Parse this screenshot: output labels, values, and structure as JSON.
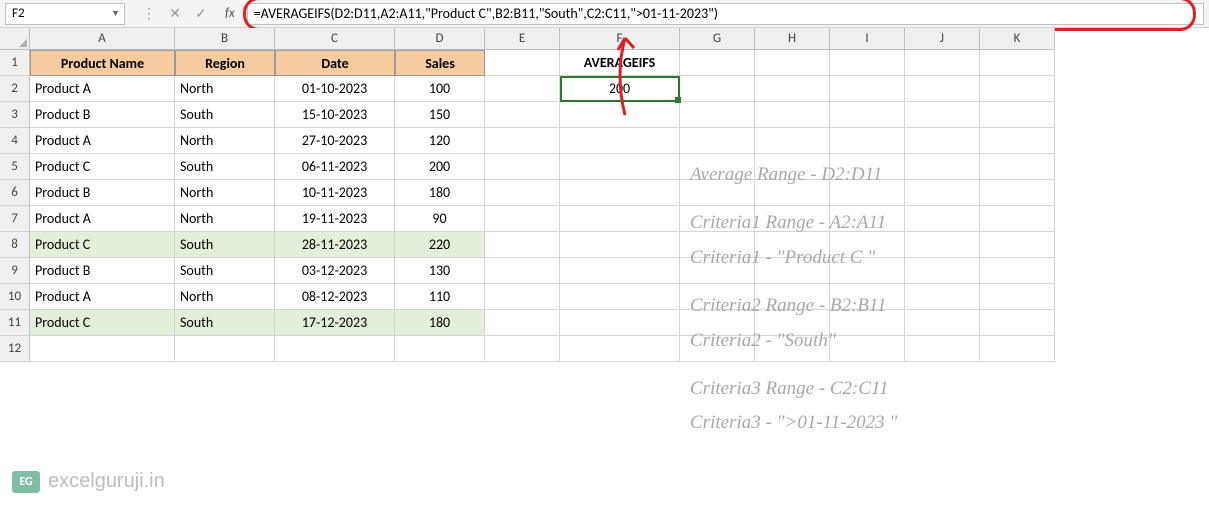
{
  "name_box": "F2",
  "formula_bar": "=AVERAGEIFS(D2:D11,A2:A11,\"Product C\",B2:B11,\"South\",C2:C11,\">01-11-2023\")",
  "columns": [
    "A",
    "B",
    "C",
    "D",
    "E",
    "F",
    "G",
    "H",
    "I",
    "J",
    "K"
  ],
  "row_numbers": [
    "1",
    "2",
    "3",
    "4",
    "5",
    "6",
    "7",
    "8",
    "9",
    "10",
    "11",
    "12"
  ],
  "headers": {
    "A": "Product Name",
    "B": "Region",
    "C": "Date",
    "D": "Sales"
  },
  "averageifs_label": "AVERAGEIFS",
  "averageifs_value": "200",
  "table": [
    {
      "A": "Product A",
      "B": "North",
      "C": "01-10-2023",
      "D": "100",
      "hl": false
    },
    {
      "A": "Product B",
      "B": "South",
      "C": "15-10-2023",
      "D": "150",
      "hl": false
    },
    {
      "A": "Product A",
      "B": "North",
      "C": "27-10-2023",
      "D": "120",
      "hl": false
    },
    {
      "A": "Product C",
      "B": "South",
      "C": "06-11-2023",
      "D": "200",
      "hl": false
    },
    {
      "A": "Product B",
      "B": "North",
      "C": "10-11-2023",
      "D": "180",
      "hl": false
    },
    {
      "A": "Product A",
      "B": "North",
      "C": "19-11-2023",
      "D": "90",
      "hl": false
    },
    {
      "A": "Product C",
      "B": "South",
      "C": "28-11-2023",
      "D": "220",
      "hl": true
    },
    {
      "A": "Product B",
      "B": "South",
      "C": "03-12-2023",
      "D": "130",
      "hl": false
    },
    {
      "A": "Product A",
      "B": "North",
      "C": "08-12-2023",
      "D": "110",
      "hl": false
    },
    {
      "A": "Product C",
      "B": "South",
      "C": "17-12-2023",
      "D": "180",
      "hl": true
    }
  ],
  "annotations": [
    "Average Range - D2:D11",
    "Criteria1 Range - A2:A11",
    "Criteria1 - \"Product C \"",
    "Criteria2 Range - B2:B11",
    "Criteria2 - \"South\"",
    "Criteria3 Range - C2:C11",
    "Criteria3 - \">01-11-2023 \""
  ],
  "watermark": "excelguruji.in",
  "wm_logo": "EG",
  "fx": "fx"
}
